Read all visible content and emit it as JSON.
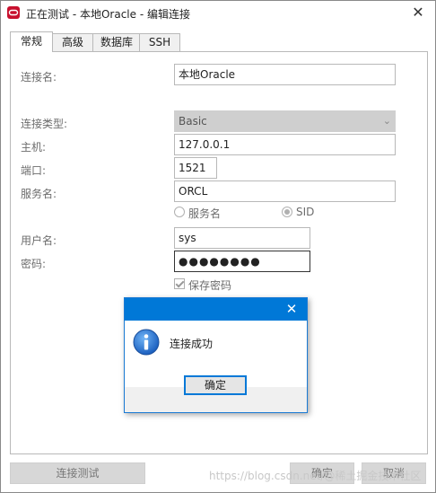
{
  "window": {
    "title": "正在测试 - 本地Oracle - 编辑连接",
    "close_glyph": "✕",
    "accent_color": "#c8102e"
  },
  "tabs": [
    {
      "label": "常规",
      "active": true
    },
    {
      "label": "高级",
      "active": false
    },
    {
      "label": "数据库",
      "active": false
    },
    {
      "label": "SSH",
      "active": false
    }
  ],
  "form": {
    "conn_name_label": "连接名:",
    "conn_name_value": "本地Oracle",
    "conn_type_label": "连接类型:",
    "conn_type_value": "Basic",
    "host_label": "主机:",
    "host_value": "127.0.0.1",
    "port_label": "端口:",
    "port_value": "1521",
    "service_label": "服务名:",
    "service_value": "ORCL",
    "radio_service_label": "服务名",
    "radio_sid_label": "SID",
    "radio_selected": "SID",
    "user_label": "用户名:",
    "user_value": "sys",
    "password_label": "密码:",
    "password_mask": "●●●●●●●●",
    "save_password_label": "保存密码",
    "save_password_checked": true
  },
  "buttons": {
    "test_label": "连接测试",
    "ok_label": "确定",
    "cancel_label": "取消"
  },
  "watermark": "https://blog.csdn.net/@稀土掘金技术社区",
  "dialog": {
    "message": "连接成功",
    "ok_label": "确定",
    "close_glyph": "✕",
    "title_color": "#0078d7"
  }
}
